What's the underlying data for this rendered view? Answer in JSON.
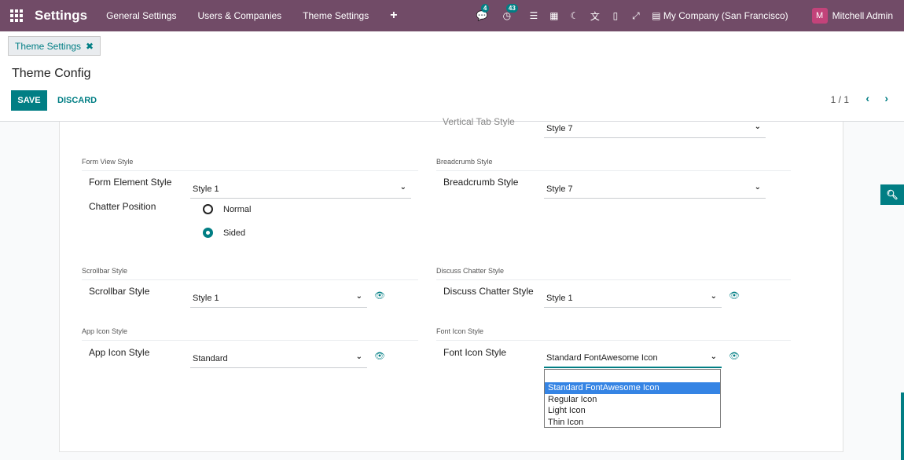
{
  "navbar": {
    "brand": "Settings",
    "menu": [
      "General Settings",
      "Users & Companies",
      "Theme Settings"
    ],
    "plus": "+",
    "chat_badge": "4",
    "activity_badge": "43",
    "company": "My Company (San Francisco)",
    "avatar_letter": "M",
    "user": "Mitchell Admin"
  },
  "control": {
    "tab_label": "Theme Settings",
    "tab_close": "✖",
    "title": "Theme Config",
    "save_label": "SAVE",
    "discard_label": "DISCARD",
    "pager": "1 / 1"
  },
  "form": {
    "vertical_tab": {
      "label": "Vertical Tab Style",
      "value": "Style 7"
    },
    "form_view": {
      "section": "Form View Style",
      "element_label": "Form Element Style",
      "element_value": "Style 1",
      "chatter_label": "Chatter Position",
      "chatter_options": [
        "Normal",
        "Sided"
      ],
      "chatter_selected": "Sided"
    },
    "breadcrumb": {
      "section": "Breadcrumb Style",
      "label": "Breadcrumb Style",
      "value": "Style 7"
    },
    "scrollbar": {
      "section": "Scrollbar Style",
      "label": "Scrollbar Style",
      "value": "Style 1"
    },
    "discuss": {
      "section": "Discuss Chatter Style",
      "label": "Discuss Chatter Style",
      "value": "Style 1"
    },
    "app_icon": {
      "section": "App Icon Style",
      "label": "App Icon Style",
      "value": "Standard"
    },
    "font_icon": {
      "section": "Font Icon Style",
      "label": "Font Icon Style",
      "value": "Standard FontAwesome Icon",
      "options": [
        "",
        "Standard FontAwesome Icon",
        "Regular Icon",
        "Light Icon",
        "Thin Icon"
      ],
      "highlighted": "Standard FontAwesome Icon"
    }
  },
  "colors": {
    "primary": "#714b67",
    "accent": "#017e84"
  }
}
